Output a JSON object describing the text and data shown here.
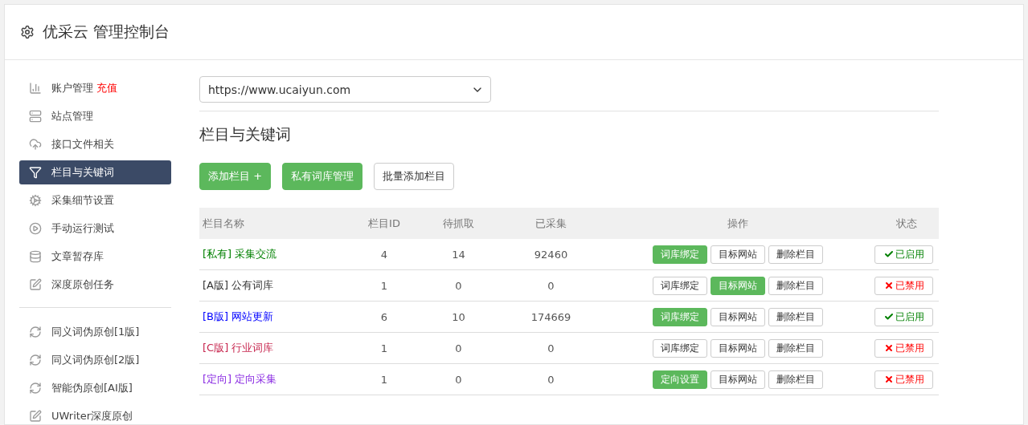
{
  "header": {
    "title": "优采云 管理控制台"
  },
  "sidebar": {
    "items": [
      {
        "kind": "link",
        "label": "账户管理",
        "badge": "充值",
        "selected": false
      },
      {
        "kind": "link",
        "label": "站点管理",
        "selected": false
      },
      {
        "kind": "link",
        "label": "接口文件相关",
        "selected": false
      },
      {
        "kind": "link",
        "label": "栏目与关键词",
        "selected": true
      },
      {
        "kind": "link",
        "label": "采集细节设置",
        "selected": false
      },
      {
        "kind": "link",
        "label": "手动运行测试",
        "selected": false
      },
      {
        "kind": "link",
        "label": "文章暂存库",
        "selected": false
      },
      {
        "kind": "link",
        "label": "深度原创任务",
        "selected": false
      },
      {
        "kind": "divider"
      },
      {
        "kind": "link",
        "label": "同义词伪原创[1版]",
        "selected": false
      },
      {
        "kind": "link",
        "label": "同义词伪原创[2版]",
        "selected": false
      },
      {
        "kind": "link",
        "label": "智能伪原创[AI版]",
        "selected": false
      },
      {
        "kind": "link",
        "label": "UWriter深度原创",
        "selected": false
      }
    ]
  },
  "site_select": {
    "value": "https://www.ucaiyun.com"
  },
  "section_title": "栏目与关键词",
  "actions": [
    {
      "label": "添加栏目 +",
      "primary": true
    },
    {
      "label": "私有词库管理",
      "primary": true
    },
    {
      "label": "批量添加栏目",
      "primary": false
    }
  ],
  "table": {
    "columns": [
      "栏目名称",
      "栏目ID",
      "待抓取",
      "已采集",
      "操作",
      "状态"
    ],
    "rows": [
      {
        "tag": "[私有]",
        "name": "采集交流",
        "color": "#008000",
        "id": "4",
        "pending": "14",
        "collected": "92460",
        "ops": [
          {
            "label": "词库绑定",
            "primary": true
          },
          {
            "label": "目标网站",
            "primary": false
          },
          {
            "label": "删除栏目",
            "primary": false
          }
        ],
        "status": "已启用",
        "enabled": true
      },
      {
        "tag": "[A版]",
        "name": "公有词库",
        "color": "#333333",
        "id": "1",
        "pending": "0",
        "collected": "0",
        "ops": [
          {
            "label": "词库绑定",
            "primary": false
          },
          {
            "label": "目标网站",
            "primary": true
          },
          {
            "label": "删除栏目",
            "primary": false
          }
        ],
        "status": "已禁用",
        "enabled": false
      },
      {
        "tag": "[B版]",
        "name": "网站更新",
        "color": "#0000ff",
        "id": "6",
        "pending": "10",
        "collected": "174669",
        "ops": [
          {
            "label": "词库绑定",
            "primary": true
          },
          {
            "label": "目标网站",
            "primary": false
          },
          {
            "label": "删除栏目",
            "primary": false
          }
        ],
        "status": "已启用",
        "enabled": true
      },
      {
        "tag": "[C版]",
        "name": "行业词库",
        "color": "#c7254e",
        "id": "1",
        "pending": "0",
        "collected": "0",
        "ops": [
          {
            "label": "词库绑定",
            "primary": false
          },
          {
            "label": "目标网站",
            "primary": false
          },
          {
            "label": "删除栏目",
            "primary": false
          }
        ],
        "status": "已禁用",
        "enabled": false
      },
      {
        "tag": "[定向]",
        "name": "定向采集",
        "color": "#8a2be2",
        "id": "1",
        "pending": "0",
        "collected": "0",
        "ops": [
          {
            "label": "定向设置",
            "primary": true
          },
          {
            "label": "目标网站",
            "primary": false
          },
          {
            "label": "删除栏目",
            "primary": false
          }
        ],
        "status": "已禁用",
        "enabled": false
      }
    ]
  }
}
